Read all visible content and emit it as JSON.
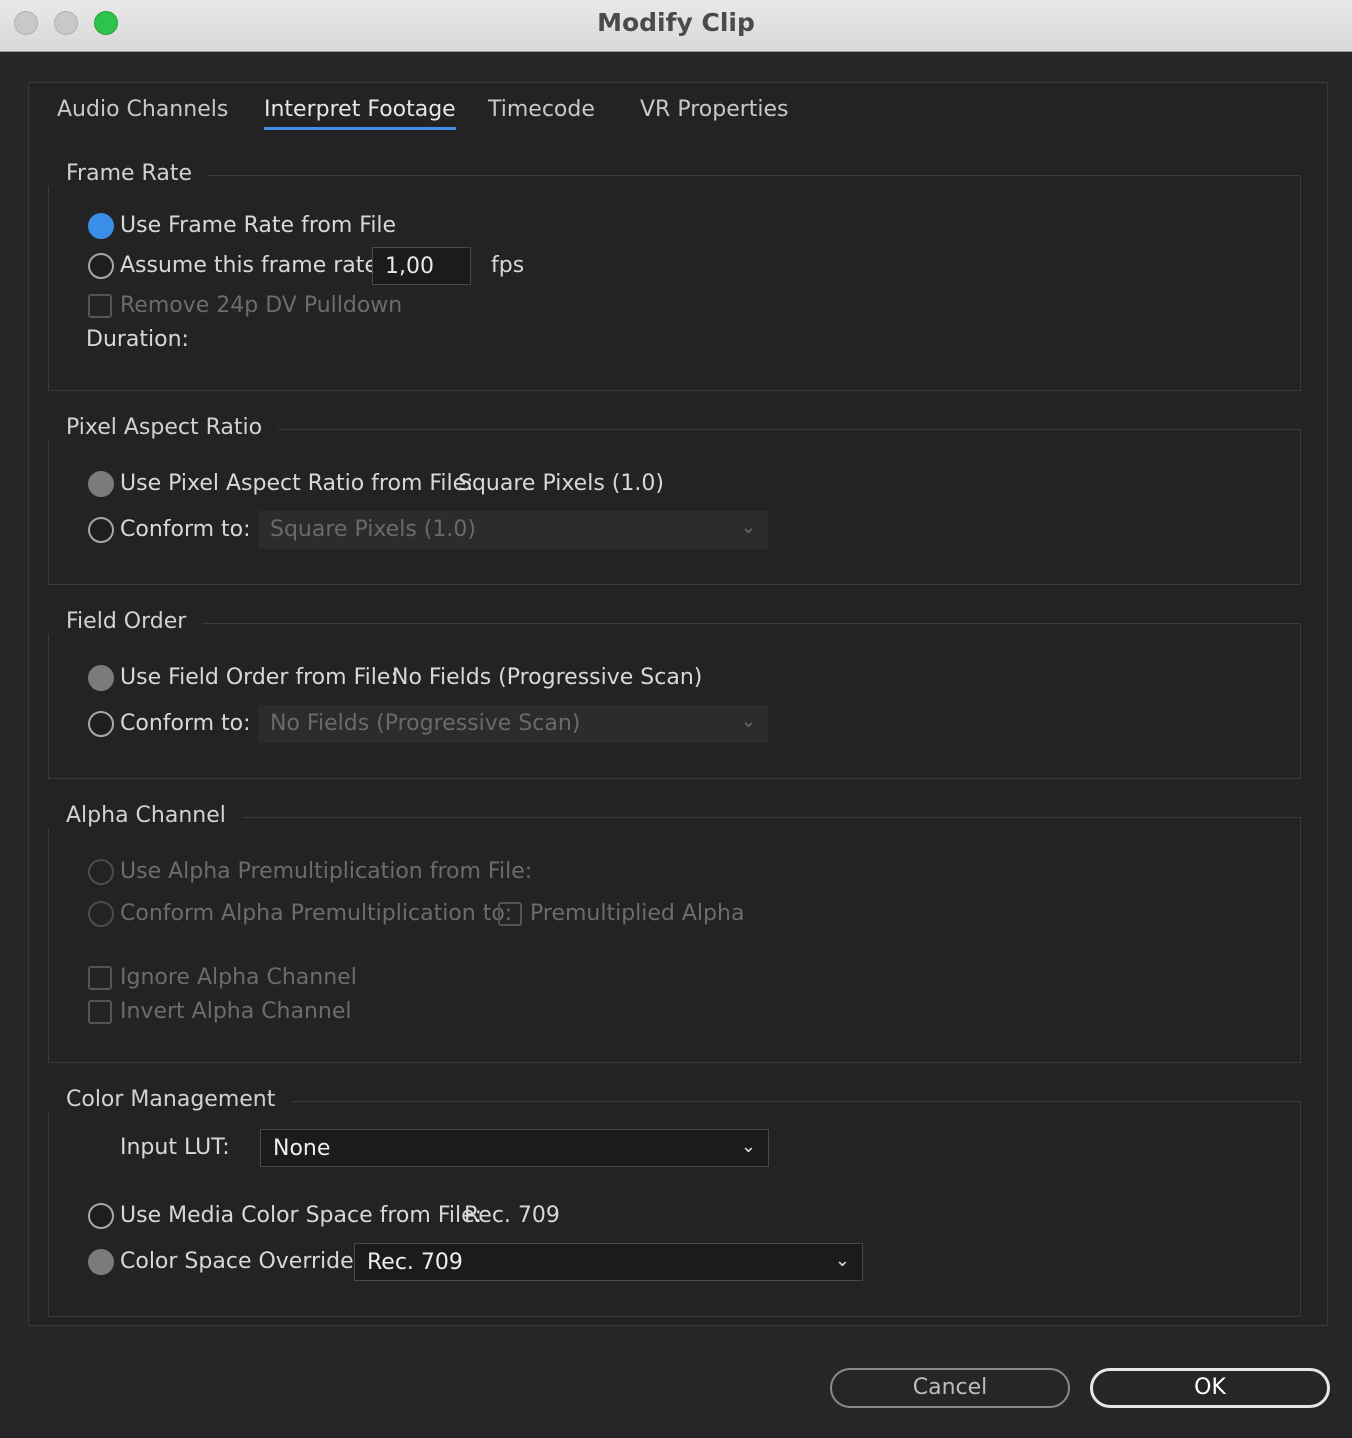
{
  "window": {
    "title": "Modify Clip"
  },
  "tabs": [
    "Audio Channels",
    "Interpret Footage",
    "Timecode",
    "VR Properties"
  ],
  "frame_rate": {
    "legend": "Frame Rate",
    "use_from_file": "Use Frame Rate from File",
    "assume": "Assume this frame rate:",
    "fps_value": "1,00",
    "fps_unit": "fps",
    "remove_pulldown": "Remove 24p DV Pulldown",
    "duration": "Duration:"
  },
  "pixel_aspect": {
    "legend": "Pixel Aspect Ratio",
    "use_from_file": "Use Pixel Aspect Ratio from File:",
    "file_value": "Square Pixels (1.0)",
    "conform": "Conform to:",
    "conform_value": "Square Pixels (1.0)"
  },
  "field_order": {
    "legend": "Field Order",
    "use_from_file": "Use Field Order from File:",
    "file_value": "No Fields (Progressive Scan)",
    "conform": "Conform to:",
    "conform_value": "No Fields (Progressive Scan)"
  },
  "alpha": {
    "legend": "Alpha Channel",
    "use_from_file": "Use Alpha Premultiplication from File:",
    "conform": "Conform Alpha Premultiplication to:",
    "premultiplied": "Premultiplied Alpha",
    "ignore": "Ignore Alpha Channel",
    "invert": "Invert Alpha Channel"
  },
  "color": {
    "legend": "Color Management",
    "input_lut_label": "Input LUT:",
    "input_lut_value": "None",
    "use_media": "Use Media Color Space from File:",
    "media_value": "Rec. 709",
    "override": "Color Space Override:",
    "override_value": "Rec. 709"
  },
  "buttons": {
    "cancel": "Cancel",
    "ok": "OK"
  },
  "colors": {
    "accent": "#3a8ee8",
    "close_green": "#2ec44c"
  }
}
